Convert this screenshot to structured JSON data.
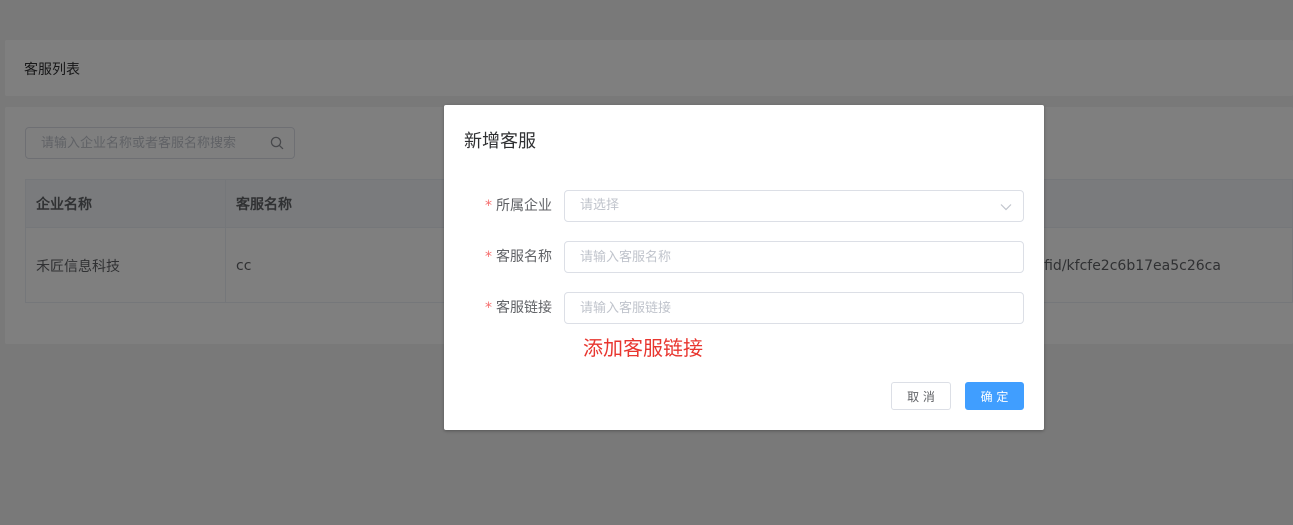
{
  "panel": {
    "title": "客服列表"
  },
  "search": {
    "placeholder": "请输入企业名称或者客服名称搜索"
  },
  "table": {
    "headers": [
      "企业名称",
      "客服名称"
    ],
    "rows": [
      {
        "company": "禾匠信息科技",
        "name": "cc",
        "link": "kfid/kfcfe2c6b17ea5c26ca"
      }
    ]
  },
  "dialog": {
    "title": "新增客服",
    "fields": [
      {
        "label": "所属企业",
        "placeholder": "请选择"
      },
      {
        "label": "客服名称",
        "placeholder": "请输入客服名称"
      },
      {
        "label": "客服链接",
        "placeholder": "请输入客服链接"
      }
    ],
    "hint": "添加客服链接",
    "cancel_label": "取 消",
    "ok_label": "确 定"
  },
  "colors": {
    "primary": "#409eff",
    "required": "#f56c6c",
    "hint": "#e8362f"
  },
  "icons": {
    "search": "search-icon",
    "select_arrow": "chevron-down-icon"
  }
}
